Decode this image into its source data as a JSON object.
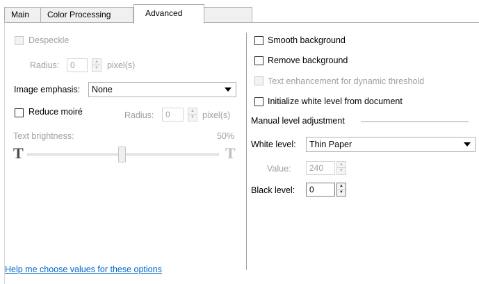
{
  "tabs": [
    {
      "label": "Main"
    },
    {
      "label": "Color Processing"
    },
    {
      "label": "Advanced"
    }
  ],
  "left": {
    "despeckle_label": "Despeckle",
    "despeckle_radius_label": "Radius:",
    "despeckle_radius_value": "0",
    "despeckle_unit": "pixel(s)",
    "image_emphasis_label": "Image emphasis:",
    "image_emphasis_value": "None",
    "reduce_moire_label": "Reduce moiré",
    "moire_radius_label": "Radius:",
    "moire_radius_value": "0",
    "moire_unit": "pixel(s)",
    "text_brightness_label": "Text brightness:",
    "text_brightness_value": "50%",
    "text_brightness_level": 0.5,
    "slider_left_glyph": "T",
    "slider_right_glyph": "T"
  },
  "right": {
    "smooth_background_label": "Smooth background",
    "remove_background_label": "Remove background",
    "text_enhancement_label": "Text enhancement for dynamic threshold",
    "initialize_white_label": "Initialize white level from document",
    "manual_level_heading": "Manual level adjustment",
    "white_level_label": "White level:",
    "white_level_value": "Thin Paper",
    "value_label": "Value:",
    "value_value": "240",
    "black_level_label": "Black level:",
    "black_level_value": "0"
  },
  "footer": {
    "help_link": "Help me choose values for these options"
  },
  "colors": {
    "link": "#0066cc",
    "disabled_text": "#a0a0a0"
  }
}
